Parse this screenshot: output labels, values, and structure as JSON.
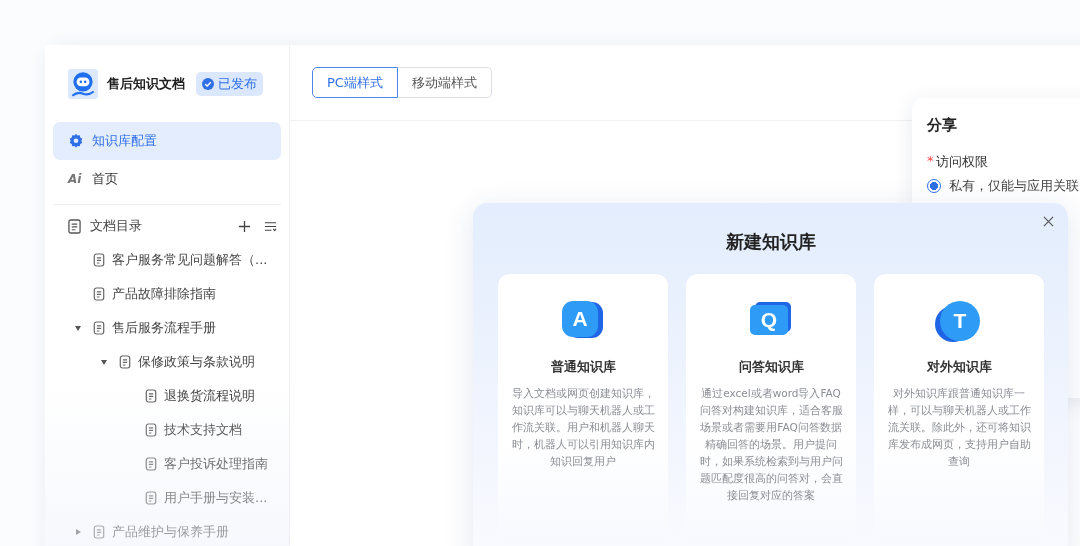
{
  "sidebar": {
    "title": "售后知识文档",
    "badge": "已发布",
    "nav": [
      {
        "label": "知识库配置",
        "kind": "gear",
        "selected": true
      },
      {
        "label": "首页",
        "kind": "ai",
        "icon_text": "Ai",
        "selected": false
      }
    ],
    "tree": {
      "title": "文档目录",
      "items": [
        {
          "label": "客户服务常见问题解答（..."
        },
        {
          "label": "产品故障排除指南"
        },
        {
          "label": "售后服务流程手册",
          "expanded": true,
          "children": [
            {
              "label": "保修政策与条款说明",
              "expanded": true,
              "children": [
                {
                  "label": "退换货流程说明"
                },
                {
                  "label": "技术支持文档"
                },
                {
                  "label": "客户投诉处理指南"
                },
                {
                  "label": "用户手册与安装..."
                }
              ]
            }
          ]
        },
        {
          "label": "产品维护与保养手册",
          "expanded": false
        }
      ]
    }
  },
  "tabs": [
    {
      "label": "PC端样式",
      "selected": true
    },
    {
      "label": "移动端样式",
      "selected": false
    }
  ],
  "share": {
    "title": "分享",
    "field_label": "访问权限",
    "required_mark": "*",
    "option": {
      "label": "私有，仅能与应用关联",
      "selected": true
    }
  },
  "modal": {
    "title": "新建知识库",
    "cards": [
      {
        "kind": "bubble",
        "icon_letter": "A",
        "title": "普通知识库",
        "description": "导入文档或网页创建知识库，知识库可以与聊天机器人或工作流关联。用户和机器人聊天时，机器人可以引用知识库内知识回复用户"
      },
      {
        "kind": "speech",
        "icon_letter": "Q",
        "title": "问答知识库",
        "description": "通过excel或者word导入FAQ问答对构建知识库，适合客服场景或者需要用FAQ问答数据精确回答的场景。用户提问时，如果系统检索到与用户问题匹配度很高的问答对，会直接回复对应的答案"
      },
      {
        "kind": "circle",
        "icon_letter": "T",
        "title": "对外知识库",
        "description": "对外知识库跟普通知识库一样，可以与聊天机器人或工作流关联。除此外，还可将知识库发布成网页，支持用户自助查询"
      }
    ]
  }
}
